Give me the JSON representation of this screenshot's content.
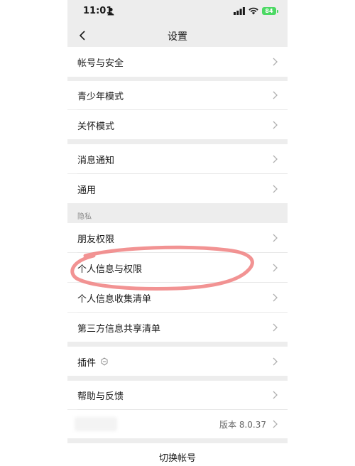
{
  "status_bar": {
    "time": "11:01",
    "battery": "84"
  },
  "nav": {
    "title": "设置"
  },
  "rows": {
    "account": "帐号与安全",
    "youth": "青少年模式",
    "care": "关怀模式",
    "notifications": "消息通知",
    "general": "通用",
    "privacy_header": "隐私",
    "friends_perm": "朋友权限",
    "personal_info_perm": "个人信息与权限",
    "info_collection": "个人信息收集清单",
    "third_party": "第三方信息共享清单",
    "plugins": "插件",
    "help": "帮助与反馈",
    "version": "版本 8.0.37"
  },
  "footer": {
    "switch_account": "切换帐号"
  },
  "colors": {
    "background": "#ededed",
    "card": "#ffffff",
    "battery": "#4cd964",
    "annotation": "#f08080"
  }
}
